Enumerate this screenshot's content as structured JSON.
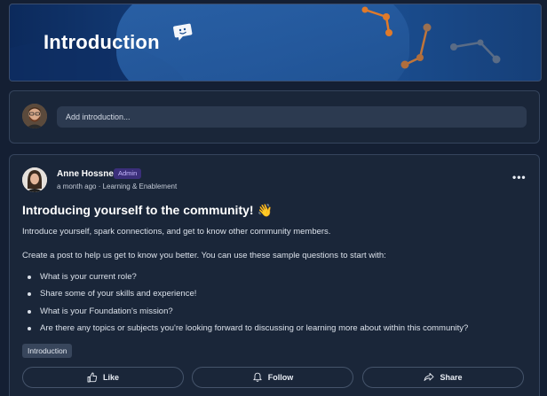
{
  "banner": {
    "title": "Introduction"
  },
  "composer": {
    "placeholder": "Add introduction..."
  },
  "post": {
    "author": "Anne Hossner",
    "badge": "Admin",
    "meta": "a month ago · Learning & Enablement",
    "title": "Introducing yourself to the community! 👋",
    "intro": "Introduce yourself, spark connections, and get to know other community members.",
    "prompt": "Create a post to help us get to know you better. You can use these sample questions to start with:",
    "questions": [
      "What is your current role?",
      "Share some of your skills and experience!",
      "What is your Foundation's mission?",
      "Are there any topics or subjects you're looking forward to discussing or learning more about within this community?"
    ],
    "tag": "Introduction",
    "actions": {
      "like": "Like",
      "follow": "Follow",
      "share": "Share"
    },
    "more": "•••"
  },
  "colors": {
    "accent": "#e07a2a",
    "badge_bg": "#3b2f7a",
    "background": "#141f33"
  },
  "icons": [
    "chat-icon",
    "more-icon",
    "thumbs-up-icon",
    "bell-icon",
    "share-icon"
  ]
}
